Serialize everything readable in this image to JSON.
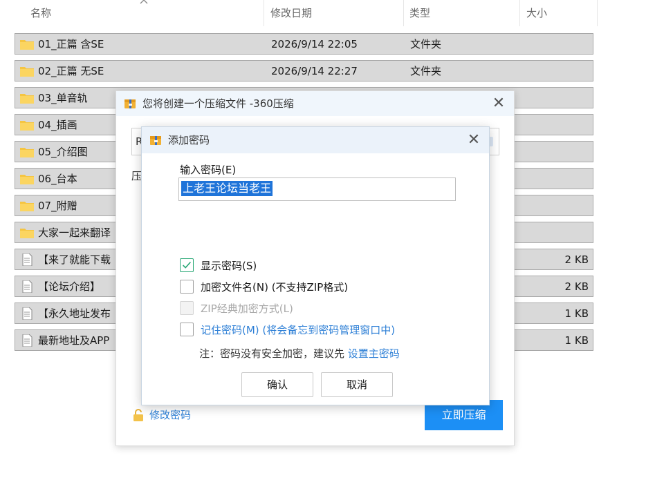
{
  "explorer": {
    "columns": {
      "name": "名称",
      "date": "修改日期",
      "type": "类型",
      "size": "大小"
    },
    "rows": [
      {
        "name": "01_正篇 含SE",
        "date": "2026/9/14 22:05",
        "type": "文件夹",
        "size": "",
        "icon": "folder-icon"
      },
      {
        "name": "02_正篇 无SE",
        "date": "2026/9/14 22:27",
        "type": "文件夹",
        "size": "",
        "icon": "folder-icon"
      },
      {
        "name": "03_单音轨",
        "date": "",
        "type": "",
        "size": "",
        "icon": "folder-icon"
      },
      {
        "name": "04_插画",
        "date": "",
        "type": "",
        "size": "",
        "icon": "folder-icon"
      },
      {
        "name": "05_介绍图",
        "date": "",
        "type": "",
        "size": "",
        "icon": "folder-icon"
      },
      {
        "name": "06_台本",
        "date": "",
        "type": "",
        "size": "",
        "icon": "folder-icon"
      },
      {
        "name": "07_附赠",
        "date": "",
        "type": "",
        "size": "",
        "icon": "folder-icon"
      },
      {
        "name": "大家一起来翻译",
        "date": "",
        "type": "",
        "size": "",
        "icon": "folder-icon"
      },
      {
        "name": "【来了就能下载",
        "date": "",
        "type": "",
        "size": "2 KB",
        "icon": "text-file-icon"
      },
      {
        "name": "【论坛介绍】",
        "date": "",
        "type": "",
        "size": "2 KB",
        "icon": "text-file-icon"
      },
      {
        "name": "【永久地址发布",
        "date": "",
        "type": "",
        "size": "1 KB",
        "icon": "text-file-icon"
      },
      {
        "name": "最新地址及APP",
        "date": "",
        "type": "",
        "size": "1 KB",
        "icon": "text-file-icon"
      }
    ]
  },
  "compress_dialog": {
    "title": "您将创建一个压缩文件 -360压缩",
    "field_partial": "R",
    "label_partial": "压",
    "change_password": "修改密码",
    "compress_now": "立即压缩"
  },
  "password_dialog": {
    "title": "添加密码",
    "input_label": "输入密码(E)",
    "password_value": "上老王论坛当老王",
    "options": {
      "show_password": {
        "label": "显示密码(S)",
        "checked": true
      },
      "encrypt_filenames": {
        "label": "加密文件名(N) (不支持ZIP格式)",
        "checked": false
      },
      "zip_classic": {
        "label": "ZIP经典加密方式(L)",
        "checked": false,
        "disabled": true
      },
      "remember_password": {
        "label": "记住密码(M) (将会备忘到密码管理窗口中)",
        "checked": false
      }
    },
    "note_text": "注：密码没有安全加密，建议先 ",
    "note_link": "设置主密码",
    "ok": "确认",
    "cancel": "取消"
  },
  "colors": {
    "accent": "#1c8ff5",
    "link": "#2d7fd6",
    "selection": "#1f74d9",
    "row_selected": "#d9d9d9",
    "checkbox_check": "#2aa876"
  }
}
